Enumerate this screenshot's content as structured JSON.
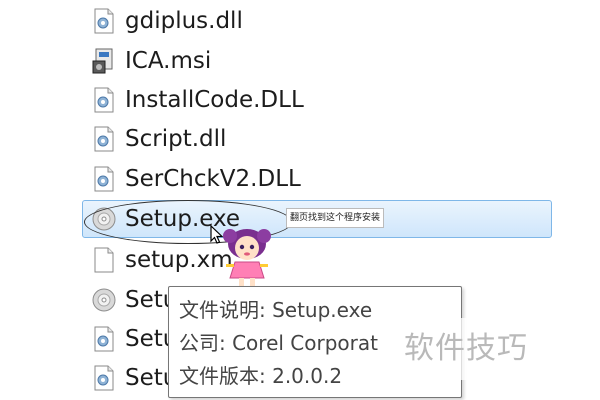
{
  "files": [
    {
      "name": "gdiplus.dll",
      "icon": "dll-file-icon"
    },
    {
      "name": "ICA.msi",
      "icon": "msi-installer-icon"
    },
    {
      "name": "InstallCode.DLL",
      "icon": "dll-file-icon"
    },
    {
      "name": "Script.dll",
      "icon": "dll-file-icon"
    },
    {
      "name": "SerChckV2.DLL",
      "icon": "dll-file-icon"
    },
    {
      "name": "Setup.exe",
      "icon": "disc-setup-icon",
      "selected": true
    },
    {
      "name": "setup.xm",
      "icon": "blank-file-icon"
    },
    {
      "name": "Setu",
      "icon": "disc-setup-icon"
    },
    {
      "name": "Setu",
      "icon": "dll-file-icon"
    },
    {
      "name": "Setu",
      "icon": "dll-file-icon"
    }
  ],
  "annotation": {
    "callout_text": "翻页找到这个程序安装"
  },
  "tooltip": {
    "description": "文件说明: Setup.exe",
    "company": "公司: Corel Corporat",
    "version": "文件版本: 2.0.0.2"
  },
  "watermark": "软件技巧",
  "colors": {
    "selection_bg": "#cfe6fb",
    "selection_border": "#7fb7e8",
    "text": "#1c1c1c",
    "watermark_text": "#b9b9b9"
  }
}
